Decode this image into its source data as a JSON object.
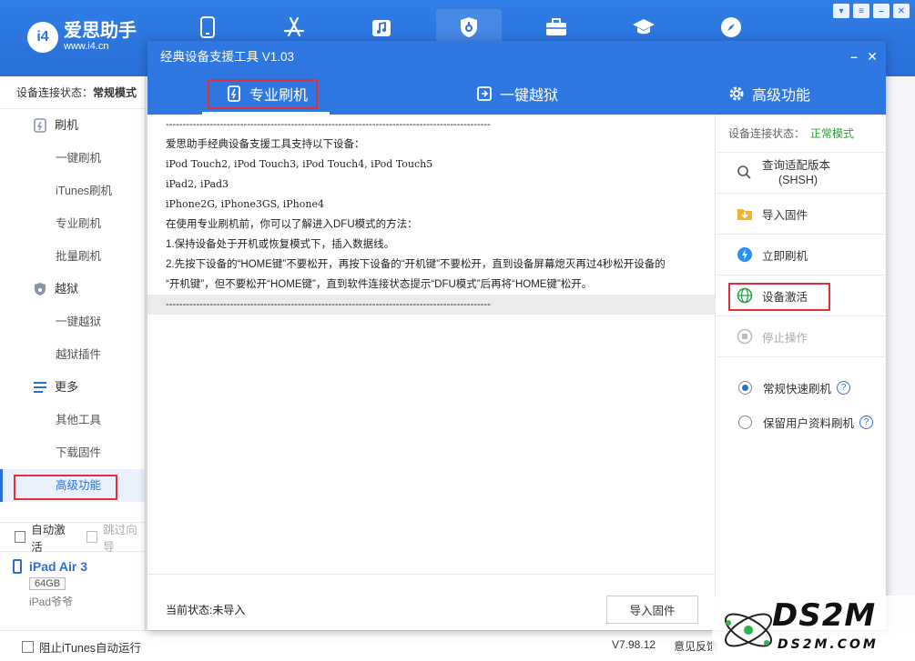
{
  "app": {
    "logo_mark": "i4",
    "name": "爱思助手",
    "url": "www.i4.cn",
    "nav_icons": [
      "phone-icon",
      "appstore-icon",
      "music-icon",
      "shield-icon",
      "toolbox-icon",
      "graduation-cap-icon",
      "compass-icon"
    ],
    "window_controls": [
      "shirt-icon",
      "list-icon",
      "minimize-icon",
      "close-icon"
    ]
  },
  "sidebar": {
    "status_label": "设备连接状态：",
    "status_value": "常规模式",
    "groups": [
      {
        "label": "刷机",
        "icon": "flash-icon",
        "items": [
          "一键刷机",
          "iTunes刷机",
          "专业刷机",
          "批量刷机"
        ]
      },
      {
        "label": "越狱",
        "icon": "jailbreak-shield-icon",
        "items": [
          "一键越狱",
          "越狱插件"
        ]
      },
      {
        "label": "更多",
        "icon": "more-lines-icon",
        "items": [
          "其他工具",
          "下载固件",
          "高级功能"
        ]
      }
    ],
    "auto_activate": "自动激活",
    "skip_guide": "跳过向导",
    "device_name": "iPad Air 3",
    "device_capacity": "64GB",
    "device_model": "iPad爷爷"
  },
  "footer": {
    "block_itunes": "阻止iTunes自动运行",
    "version": "V7.98.12",
    "feedback": "意见反馈"
  },
  "dialog": {
    "title": "经典设备支援工具 V1.03",
    "tabs": [
      {
        "label": "专业刷机",
        "icon": "flash-tab-icon"
      },
      {
        "label": "一键越狱",
        "icon": "jailbreak-tab-icon"
      },
      {
        "label": "高级功能",
        "icon": "gear-tab-icon"
      }
    ],
    "log_lines": [
      "------------------------------------------------------------------------------------------------",
      "爱思助手经典设备支援工具支持以下设备：",
      "iPod Touch2, iPod Touch3, iPod Touch4, iPod Touch5",
      "iPad2, iPad3",
      "iPhone2G, iPhone3GS, iPhone4",
      "在使用专业刷机前，你可以了解进入DFU模式的方法：",
      "1.保持设备处于开机或恢复模式下，插入数据线。",
      "2.先按下设备的“HOME键”不要松开，再按下设备的“开机键”不要松开，直到设备屏幕熄灭再过4秒松开设备的",
      "   “开机键”，但不要松开“HOME键”，直到软件连接状态提示“DFU模式”后再将“HOME键”松开。",
      "------------------------------------------------------------------------------------------------"
    ],
    "current_status": "当前状态:未导入",
    "import_button": "导入固件",
    "ops_status_label": "设备连接状态：",
    "ops_status_value": "正常模式",
    "ops": {
      "query_version_line1": "查询适配版本",
      "query_version_line2": "(SHSH)",
      "import_firmware": "导入固件",
      "flash_now": "立即刷机",
      "activate_device": "设备激活",
      "stop": "停止操作"
    },
    "radio_options": [
      "常规快速刷机",
      "保留用户资料刷机"
    ],
    "help_glyph": "?"
  },
  "watermark": {
    "brand": "DS2M",
    "url": "DS2M.COM"
  }
}
